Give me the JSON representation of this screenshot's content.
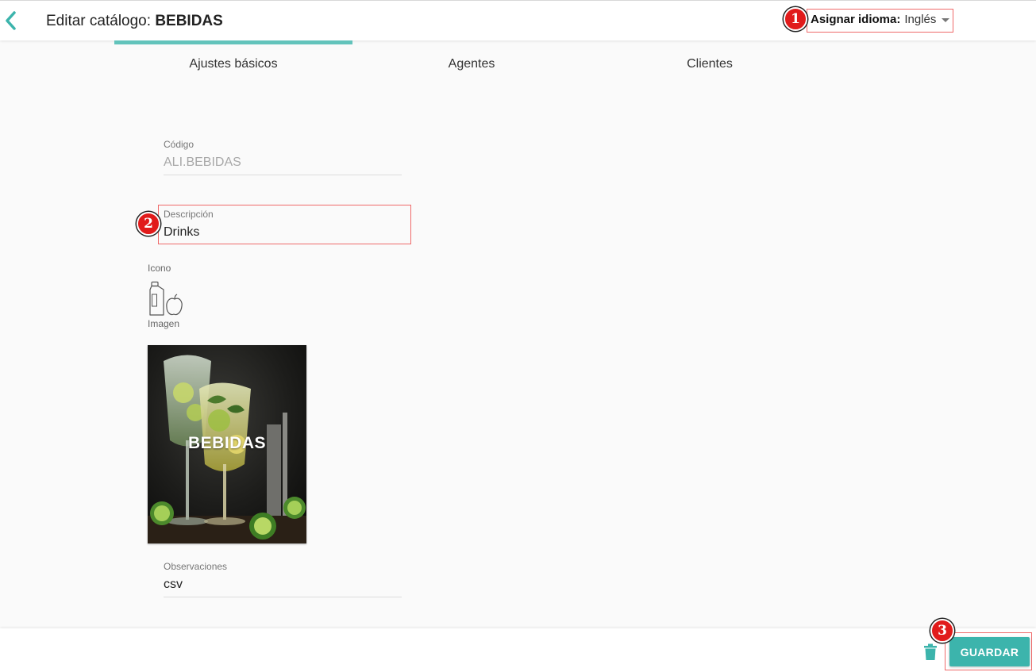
{
  "header": {
    "title_prefix": "Editar catálogo: ",
    "title_name": "BEBIDAS",
    "language_label": "Asignar idioma:",
    "language_value": "Inglés"
  },
  "tabs": [
    {
      "label": "Ajustes básicos",
      "active": true
    },
    {
      "label": "Agentes",
      "active": false
    },
    {
      "label": "Clientes",
      "active": false
    }
  ],
  "form": {
    "code": {
      "label": "Código",
      "value": "ALI.BEBIDAS"
    },
    "description": {
      "label": "Descripción",
      "value": "Drinks"
    },
    "icon_label": "Icono",
    "image_label": "Imagen",
    "image_caption": "BEBIDAS",
    "observations": {
      "label": "Observaciones",
      "value": "csv"
    }
  },
  "badges": {
    "b1": "1",
    "b2": "2",
    "b3": "3"
  },
  "footer": {
    "save_label": "GUARDAR"
  },
  "icons": {
    "back": "chevron-left-icon",
    "caret": "caret-down-icon",
    "catalog": "bottle-apple-icon",
    "trash": "trash-icon"
  },
  "colors": {
    "accent": "#3cb4ac",
    "tab_indicator": "#62c3bb",
    "annotation_border": "#ef6a6a",
    "badge": "#e11b1b"
  }
}
